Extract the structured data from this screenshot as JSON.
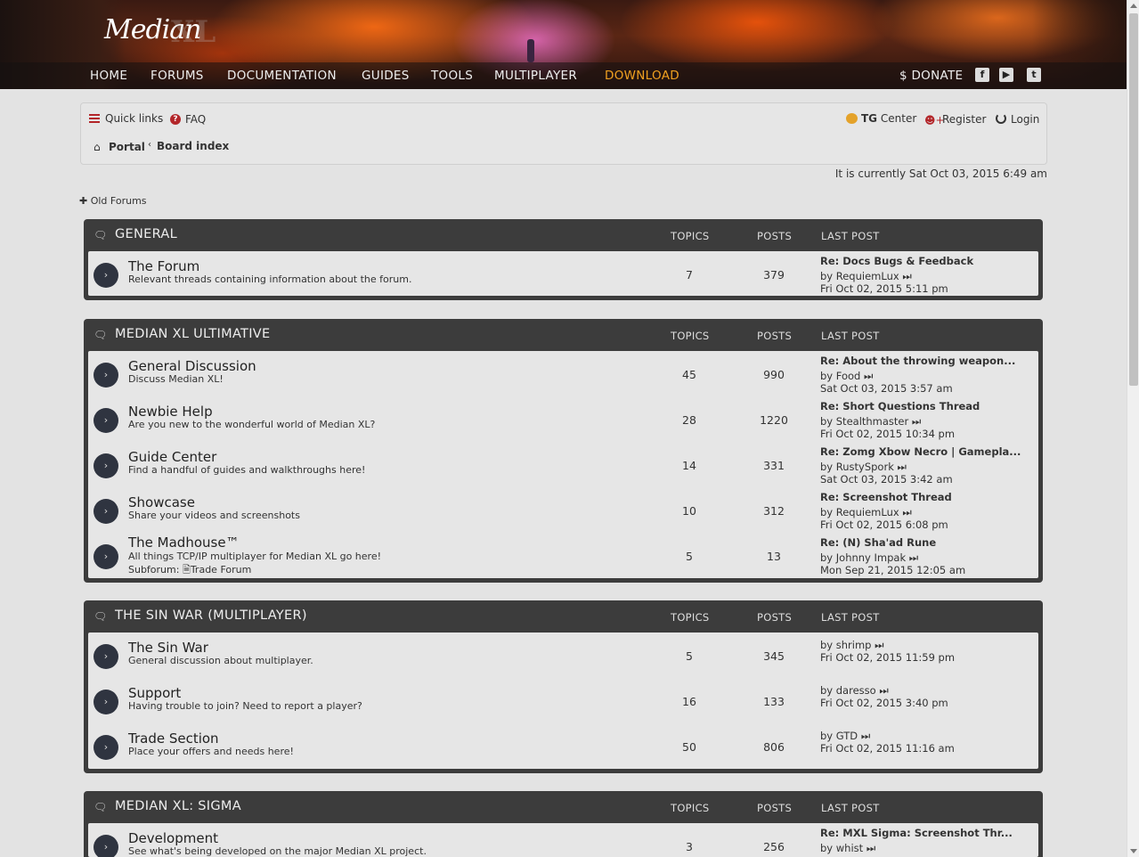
{
  "header": {
    "logo_text": "Median",
    "logo_suffix": "XL",
    "nav": [
      "HOME",
      "FORUMS",
      "DOCUMENTATION",
      "GUIDES",
      "TOOLS",
      "MULTIPLAYER",
      "DOWNLOAD"
    ],
    "donate": "$ DONATE",
    "social_icons": [
      "facebook-icon",
      "youtube-icon",
      "twitch-icon"
    ],
    "accent_color": "#f0a020"
  },
  "toppanel": {
    "quick_links": "Quick links",
    "faq": "FAQ",
    "tg_bold": "TG",
    "tg_center": "Center",
    "register": "Register",
    "login": "Login",
    "breadcrumb_portal": "Portal",
    "breadcrumb_board": "Board index"
  },
  "datetime": "It is currently Sat Oct 03, 2015 6:49 am",
  "old_forums": "Old Forums",
  "columns": {
    "topics": "TOPICS",
    "posts": "POSTS",
    "last_post": "LAST POST"
  },
  "categories": [
    {
      "title": "GENERAL",
      "forums": [
        {
          "name": "The Forum",
          "desc": "Relevant threads containing information about the forum.",
          "topics": "7",
          "posts": "379",
          "lp_title": "Re: Docs Bugs & Feedback",
          "lp_by": "by RequiemLux",
          "lp_date": "Fri Oct 02, 2015 5:11 pm"
        }
      ]
    },
    {
      "title": "MEDIAN XL ULTIMATIVE",
      "forums": [
        {
          "name": "General Discussion",
          "desc": "Discuss Median XL!",
          "topics": "45",
          "posts": "990",
          "lp_title": "Re: About the throwing weapon...",
          "lp_by": "by Food",
          "lp_date": "Sat Oct 03, 2015 3:57 am"
        },
        {
          "name": "Newbie Help",
          "desc": "Are you new to the wonderful world of Median XL?",
          "topics": "28",
          "posts": "1220",
          "lp_title": "Re: Short Questions Thread",
          "lp_by": "by Stealthmaster",
          "lp_date": "Fri Oct 02, 2015 10:34 pm"
        },
        {
          "name": "Guide Center",
          "desc": "Find a handful of guides and walkthroughs here!",
          "topics": "14",
          "posts": "331",
          "lp_title": "Re: Zomg Xbow Necro | Gamepla...",
          "lp_by": "by RustySpork",
          "lp_date": "Sat Oct 03, 2015 3:42 am"
        },
        {
          "name": "Showcase",
          "desc": "Share your videos and screenshots",
          "topics": "10",
          "posts": "312",
          "lp_title": "Re: Screenshot Thread",
          "lp_by": "by RequiemLux",
          "lp_date": "Fri Oct 02, 2015 6:08 pm"
        },
        {
          "name": "The Madhouse™",
          "desc": "All things TCP/IP multiplayer for Median XL go here!",
          "subforum_label": "Subforum:",
          "subforum": "Trade Forum",
          "topics": "5",
          "posts": "13",
          "lp_title": "Re: (N) Sha'ad Rune",
          "lp_by": "by Johnny Impak",
          "lp_date": "Mon Sep 21, 2015 12:05 am"
        }
      ]
    },
    {
      "title": "THE SIN WAR (MULTIPLAYER)",
      "forums": [
        {
          "name": "The Sin War",
          "desc": "General discussion about multiplayer.",
          "topics": "5",
          "posts": "345",
          "lp_by": "by shrimp",
          "lp_date": "Fri Oct 02, 2015 11:59 pm"
        },
        {
          "name": "Support",
          "desc": "Having trouble to join? Need to report a player?",
          "topics": "16",
          "posts": "133",
          "lp_by": "by daresso",
          "lp_date": "Fri Oct 02, 2015 3:40 pm"
        },
        {
          "name": "Trade Section",
          "desc": "Place your offers and needs here!",
          "topics": "50",
          "posts": "806",
          "lp_by": "by GTD",
          "lp_date": "Fri Oct 02, 2015 11:16 am"
        }
      ]
    },
    {
      "title": "MEDIAN XL: SIGMA",
      "forums": [
        {
          "name": "Development",
          "desc": "See what's being developed on the major Median XL project.",
          "topics": "3",
          "posts": "256",
          "lp_title": "Re: MXL Sigma: Screenshot Thr...",
          "lp_by": "by whist"
        }
      ]
    }
  ]
}
